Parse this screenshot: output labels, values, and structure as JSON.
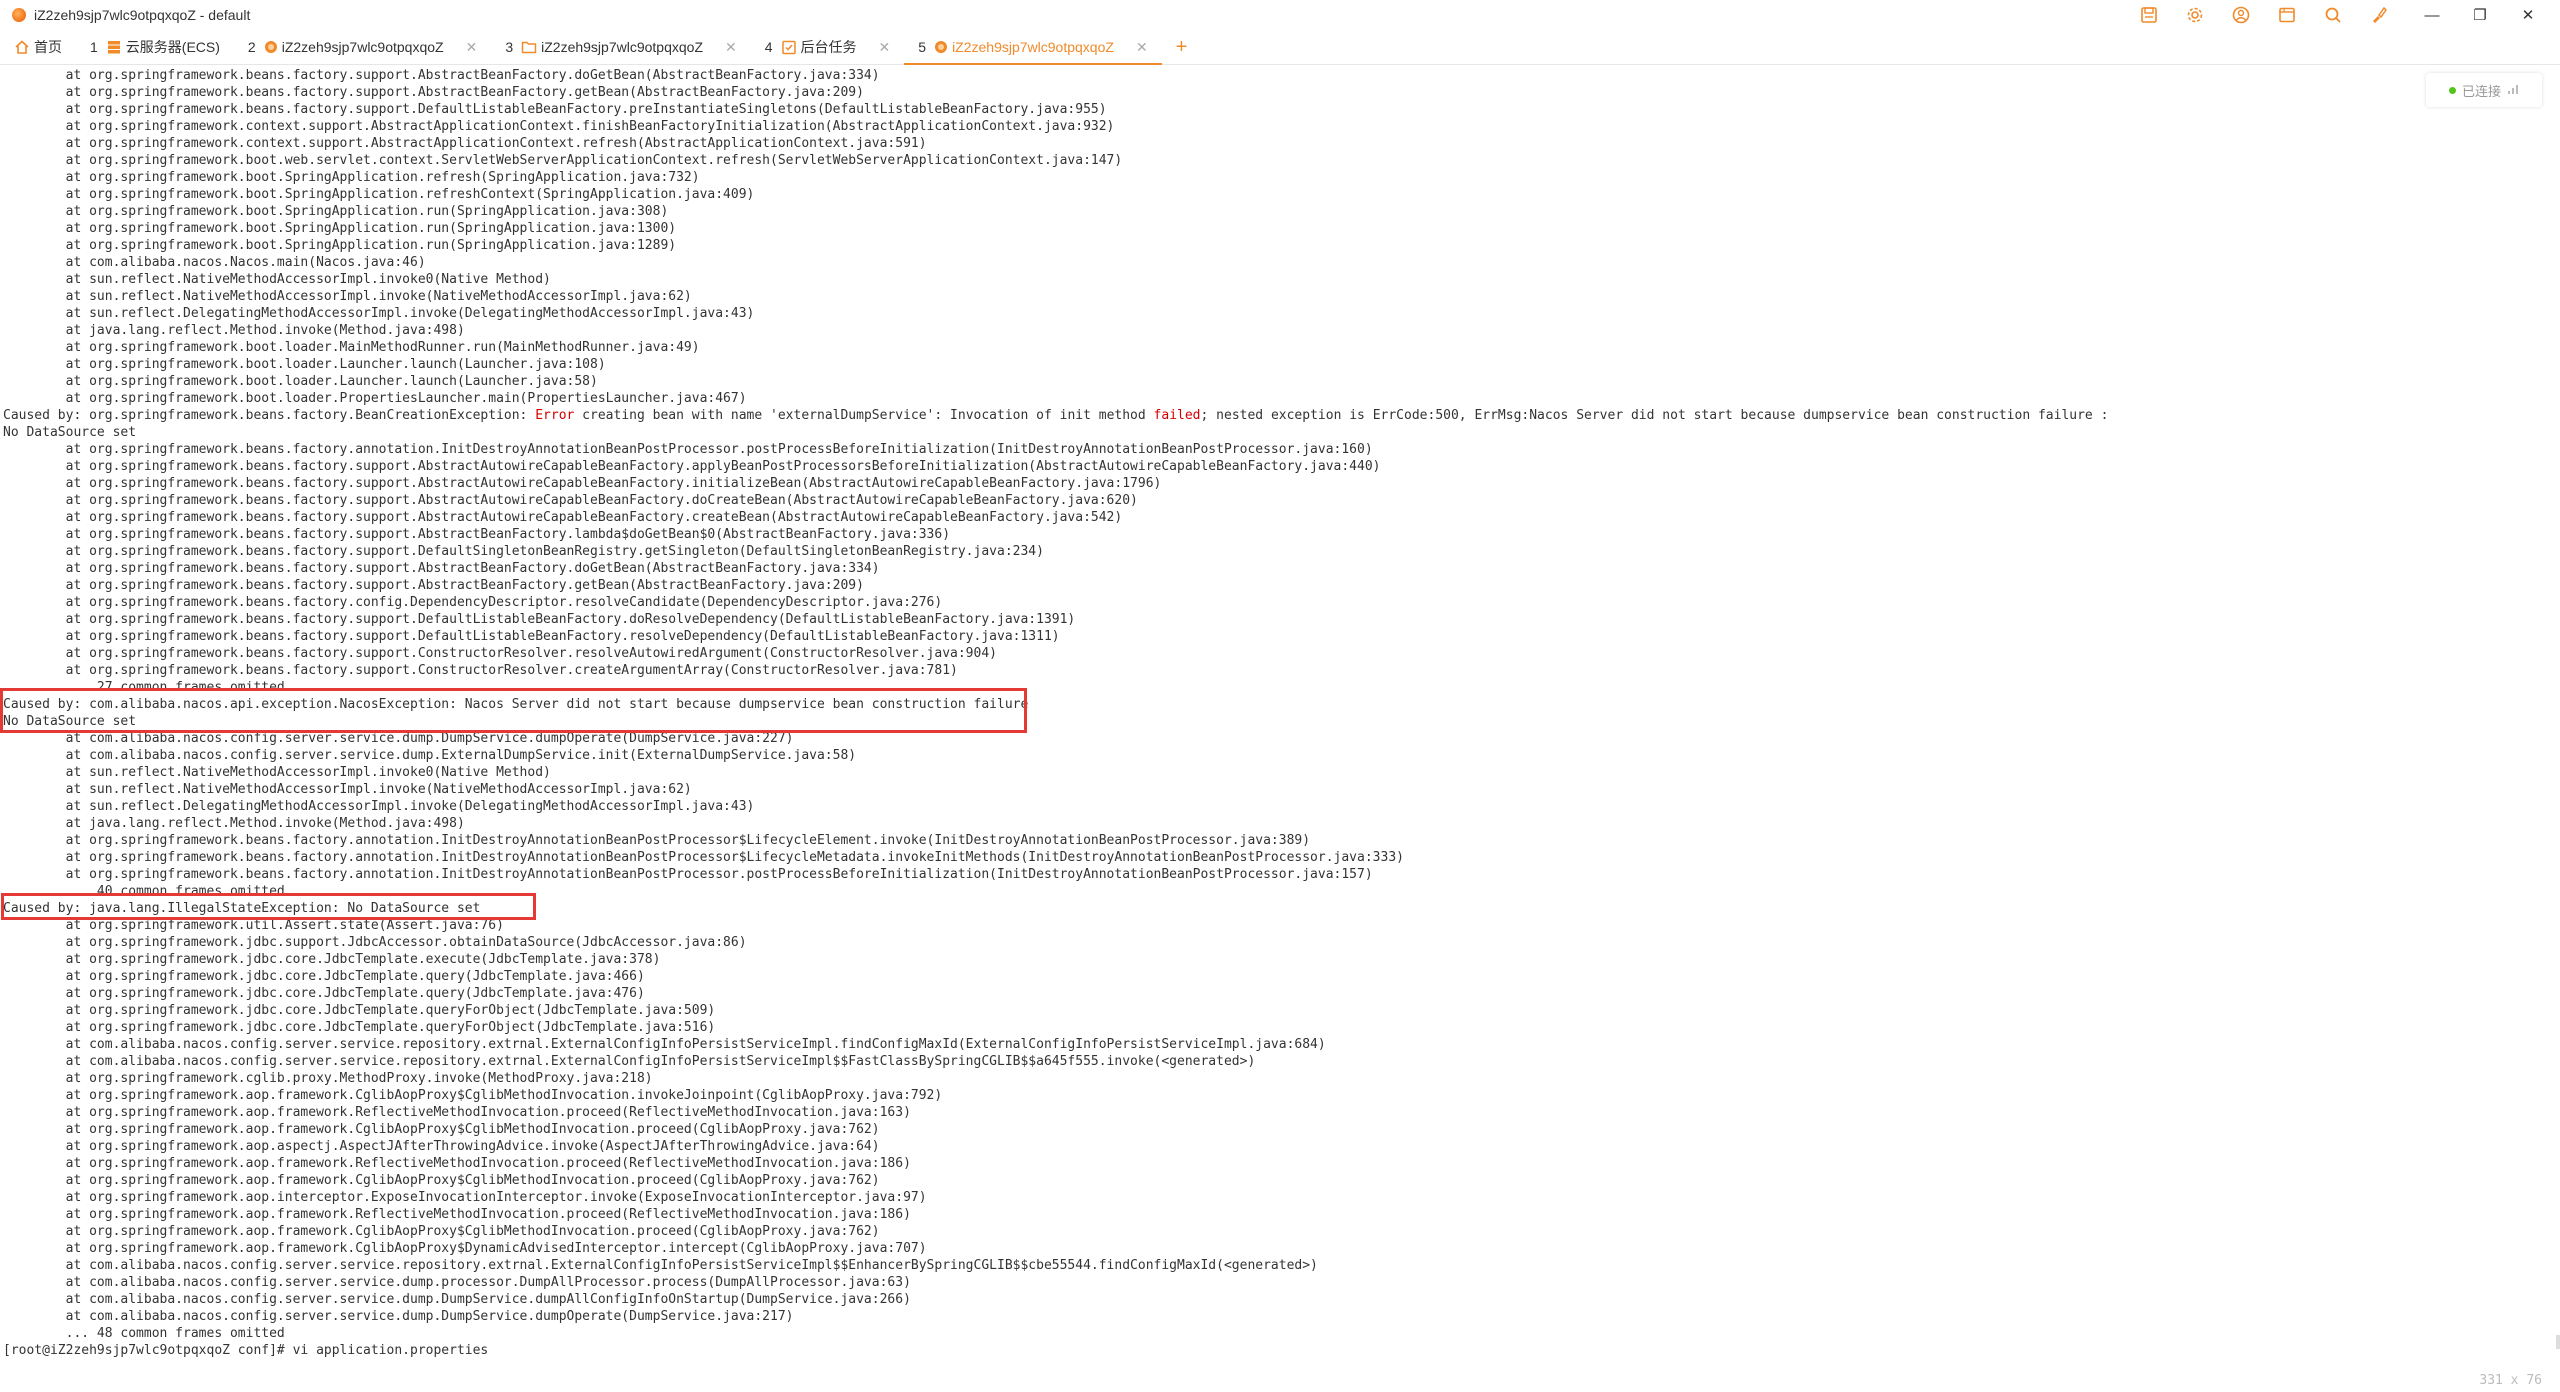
{
  "window": {
    "title": "iZ2zeh9sjp7wlc9otpqxqoZ - default"
  },
  "toolbar_icons": [
    "save-icon",
    "settings-icon",
    "user-icon",
    "window-icon",
    "search-icon",
    "paint-icon"
  ],
  "tabs": [
    {
      "num": "",
      "label": "首页",
      "icon": "home-icon",
      "closable": false,
      "active": false
    },
    {
      "num": "1",
      "label": "云服务器(ECS)",
      "icon": "server-icon",
      "closable": false,
      "active": false
    },
    {
      "num": "2",
      "label": "iZ2zeh9sjp7wlc9otpqxqoZ",
      "icon": "terminal-icon",
      "closable": true,
      "active": false
    },
    {
      "num": "3",
      "label": "iZ2zeh9sjp7wlc9otpqxqoZ",
      "icon": "folder-icon",
      "closable": true,
      "active": false
    },
    {
      "num": "4",
      "label": "后台任务",
      "icon": "task-icon",
      "closable": true,
      "active": false
    },
    {
      "num": "5",
      "label": "iZ2zeh9sjp7wlc9otpqxqoZ",
      "icon": "terminal-icon",
      "closable": true,
      "active": true
    }
  ],
  "connection": {
    "status": "已连接"
  },
  "terminal_size": "331 x 76",
  "colors": {
    "accent": "#f08a2a",
    "error": "#d40000",
    "highlight_box": "#e53935",
    "connected": "#52c41a"
  },
  "terminal_lines": [
    "        at org.springframework.beans.factory.support.AbstractBeanFactory.doGetBean(AbstractBeanFactory.java:334)",
    "        at org.springframework.beans.factory.support.AbstractBeanFactory.getBean(AbstractBeanFactory.java:209)",
    "        at org.springframework.beans.factory.support.DefaultListableBeanFactory.preInstantiateSingletons(DefaultListableBeanFactory.java:955)",
    "        at org.springframework.context.support.AbstractApplicationContext.finishBeanFactoryInitialization(AbstractApplicationContext.java:932)",
    "        at org.springframework.context.support.AbstractApplicationContext.refresh(AbstractApplicationContext.java:591)",
    "        at org.springframework.boot.web.servlet.context.ServletWebServerApplicationContext.refresh(ServletWebServerApplicationContext.java:147)",
    "        at org.springframework.boot.SpringApplication.refresh(SpringApplication.java:732)",
    "        at org.springframework.boot.SpringApplication.refreshContext(SpringApplication.java:409)",
    "        at org.springframework.boot.SpringApplication.run(SpringApplication.java:308)",
    "        at org.springframework.boot.SpringApplication.run(SpringApplication.java:1300)",
    "        at org.springframework.boot.SpringApplication.run(SpringApplication.java:1289)",
    "        at com.alibaba.nacos.Nacos.main(Nacos.java:46)",
    "        at sun.reflect.NativeMethodAccessorImpl.invoke0(Native Method)",
    "        at sun.reflect.NativeMethodAccessorImpl.invoke(NativeMethodAccessorImpl.java:62)",
    "        at sun.reflect.DelegatingMethodAccessorImpl.invoke(DelegatingMethodAccessorImpl.java:43)",
    "        at java.lang.reflect.Method.invoke(Method.java:498)",
    "        at org.springframework.boot.loader.MainMethodRunner.run(MainMethodRunner.java:49)",
    "        at org.springframework.boot.loader.Launcher.launch(Launcher.java:108)",
    "        at org.springframework.boot.loader.Launcher.launch(Launcher.java:58)",
    "        at org.springframework.boot.loader.PropertiesLauncher.main(PropertiesLauncher.java:467)",
    "Caused by: org.springframework.beans.factory.BeanCreationException: Error creating bean with name 'externalDumpService': Invocation of init method failed; nested exception is ErrCode:500, ErrMsg:Nacos Server did not start because dumpservice bean construction failure :",
    "No DataSource set",
    "        at org.springframework.beans.factory.annotation.InitDestroyAnnotationBeanPostProcessor.postProcessBeforeInitialization(InitDestroyAnnotationBeanPostProcessor.java:160)",
    "        at org.springframework.beans.factory.support.AbstractAutowireCapableBeanFactory.applyBeanPostProcessorsBeforeInitialization(AbstractAutowireCapableBeanFactory.java:440)",
    "        at org.springframework.beans.factory.support.AbstractAutowireCapableBeanFactory.initializeBean(AbstractAutowireCapableBeanFactory.java:1796)",
    "        at org.springframework.beans.factory.support.AbstractAutowireCapableBeanFactory.doCreateBean(AbstractAutowireCapableBeanFactory.java:620)",
    "        at org.springframework.beans.factory.support.AbstractAutowireCapableBeanFactory.createBean(AbstractAutowireCapableBeanFactory.java:542)",
    "        at org.springframework.beans.factory.support.AbstractBeanFactory.lambda$doGetBean$0(AbstractBeanFactory.java:336)",
    "        at org.springframework.beans.factory.support.DefaultSingletonBeanRegistry.getSingleton(DefaultSingletonBeanRegistry.java:234)",
    "        at org.springframework.beans.factory.support.AbstractBeanFactory.doGetBean(AbstractBeanFactory.java:334)",
    "        at org.springframework.beans.factory.support.AbstractBeanFactory.getBean(AbstractBeanFactory.java:209)",
    "        at org.springframework.beans.factory.config.DependencyDescriptor.resolveCandidate(DependencyDescriptor.java:276)",
    "        at org.springframework.beans.factory.support.DefaultListableBeanFactory.doResolveDependency(DefaultListableBeanFactory.java:1391)",
    "        at org.springframework.beans.factory.support.DefaultListableBeanFactory.resolveDependency(DefaultListableBeanFactory.java:1311)",
    "        at org.springframework.beans.factory.support.ConstructorResolver.resolveAutowiredArgument(ConstructorResolver.java:904)",
    "        at org.springframework.beans.factory.support.ConstructorResolver.createArgumentArray(ConstructorResolver.java:781)",
    "        ... 27 common frames omitted",
    "Caused by: com.alibaba.nacos.api.exception.NacosException: Nacos Server did not start because dumpservice bean construction failure",
    "No DataSource set",
    "        at com.alibaba.nacos.config.server.service.dump.DumpService.dumpOperate(DumpService.java:227)",
    "        at com.alibaba.nacos.config.server.service.dump.ExternalDumpService.init(ExternalDumpService.java:58)",
    "        at sun.reflect.NativeMethodAccessorImpl.invoke0(Native Method)",
    "        at sun.reflect.NativeMethodAccessorImpl.invoke(NativeMethodAccessorImpl.java:62)",
    "        at sun.reflect.DelegatingMethodAccessorImpl.invoke(DelegatingMethodAccessorImpl.java:43)",
    "        at java.lang.reflect.Method.invoke(Method.java:498)",
    "        at org.springframework.beans.factory.annotation.InitDestroyAnnotationBeanPostProcessor$LifecycleElement.invoke(InitDestroyAnnotationBeanPostProcessor.java:389)",
    "        at org.springframework.beans.factory.annotation.InitDestroyAnnotationBeanPostProcessor$LifecycleMetadata.invokeInitMethods(InitDestroyAnnotationBeanPostProcessor.java:333)",
    "        at org.springframework.beans.factory.annotation.InitDestroyAnnotationBeanPostProcessor.postProcessBeforeInitialization(InitDestroyAnnotationBeanPostProcessor.java:157)",
    "        ... 40 common frames omitted",
    "Caused by: java.lang.IllegalStateException: No DataSource set",
    "        at org.springframework.util.Assert.state(Assert.java:76)",
    "        at org.springframework.jdbc.support.JdbcAccessor.obtainDataSource(JdbcAccessor.java:86)",
    "        at org.springframework.jdbc.core.JdbcTemplate.execute(JdbcTemplate.java:378)",
    "        at org.springframework.jdbc.core.JdbcTemplate.query(JdbcTemplate.java:466)",
    "        at org.springframework.jdbc.core.JdbcTemplate.query(JdbcTemplate.java:476)",
    "        at org.springframework.jdbc.core.JdbcTemplate.queryForObject(JdbcTemplate.java:509)",
    "        at org.springframework.jdbc.core.JdbcTemplate.queryForObject(JdbcTemplate.java:516)",
    "        at com.alibaba.nacos.config.server.service.repository.extrnal.ExternalConfigInfoPersistServiceImpl.findConfigMaxId(ExternalConfigInfoPersistServiceImpl.java:684)",
    "        at com.alibaba.nacos.config.server.service.repository.extrnal.ExternalConfigInfoPersistServiceImpl$$FastClassBySpringCGLIB$$a645f555.invoke(<generated>)",
    "        at org.springframework.cglib.proxy.MethodProxy.invoke(MethodProxy.java:218)",
    "        at org.springframework.aop.framework.CglibAopProxy$CglibMethodInvocation.invokeJoinpoint(CglibAopProxy.java:792)",
    "        at org.springframework.aop.framework.ReflectiveMethodInvocation.proceed(ReflectiveMethodInvocation.java:163)",
    "        at org.springframework.aop.framework.CglibAopProxy$CglibMethodInvocation.proceed(CglibAopProxy.java:762)",
    "        at org.springframework.aop.aspectj.AspectJAfterThrowingAdvice.invoke(AspectJAfterThrowingAdvice.java:64)",
    "        at org.springframework.aop.framework.ReflectiveMethodInvocation.proceed(ReflectiveMethodInvocation.java:186)",
    "        at org.springframework.aop.framework.CglibAopProxy$CglibMethodInvocation.proceed(CglibAopProxy.java:762)",
    "        at org.springframework.aop.interceptor.ExposeInvocationInterceptor.invoke(ExposeInvocationInterceptor.java:97)",
    "        at org.springframework.aop.framework.ReflectiveMethodInvocation.proceed(ReflectiveMethodInvocation.java:186)",
    "        at org.springframework.aop.framework.CglibAopProxy$CglibMethodInvocation.proceed(CglibAopProxy.java:762)",
    "        at org.springframework.aop.framework.CglibAopProxy$DynamicAdvisedInterceptor.intercept(CglibAopProxy.java:707)",
    "        at com.alibaba.nacos.config.server.service.repository.extrnal.ExternalConfigInfoPersistServiceImpl$$EnhancerBySpringCGLIB$$cbe55544.findConfigMaxId(<generated>)",
    "        at com.alibaba.nacos.config.server.service.dump.processor.DumpAllProcessor.process(DumpAllProcessor.java:63)",
    "        at com.alibaba.nacos.config.server.service.dump.DumpService.dumpAllConfigInfoOnStartup(DumpService.java:266)",
    "        at com.alibaba.nacos.config.server.service.dump.DumpService.dumpOperate(DumpService.java:217)",
    "        ... 48 common frames omitted",
    "[root@iZ2zeh9sjp7wlc9otpqxqoZ conf]# vi application.properties"
  ],
  "error_keywords": [
    "Error",
    "failed"
  ]
}
